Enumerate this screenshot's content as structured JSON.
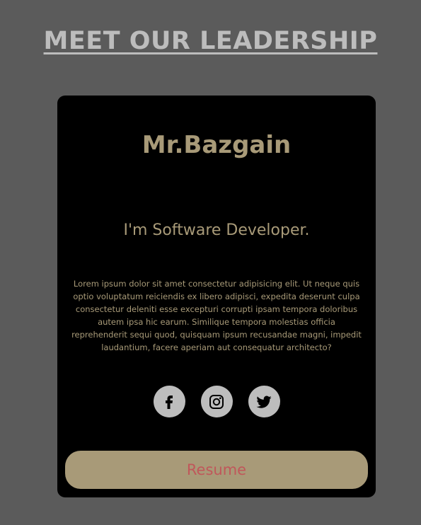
{
  "page": {
    "heading": "MEET OUR LEADERSHIP"
  },
  "card": {
    "name": "Mr.Bazgain",
    "role": "I'm Software Developer.",
    "bio": "Lorem ipsum dolor sit amet consectetur adipisicing elit. Ut neque quis optio voluptatum reiciendis ex libero adipisci, expedita deserunt culpa consectetur deleniti esse excepturi corrupti ipsam tempora doloribus autem ipsa hic earum. Similique tempora molestias officia reprehenderit sequi quod, quisquam ipsum recusandae magni, impedit laudantium, facere aperiam aut consequatur architecto?",
    "socials": [
      {
        "icon": "facebook-icon"
      },
      {
        "icon": "instagram-icon"
      },
      {
        "icon": "twitter-icon"
      }
    ],
    "resume_label": "Resume"
  },
  "colors": {
    "background": "#5b5b5b",
    "card": "#000000",
    "accent": "#a89a78",
    "heading": "#bdbdbd",
    "social_bg": "#bdbdbd",
    "resume_text": "#c0575a"
  }
}
